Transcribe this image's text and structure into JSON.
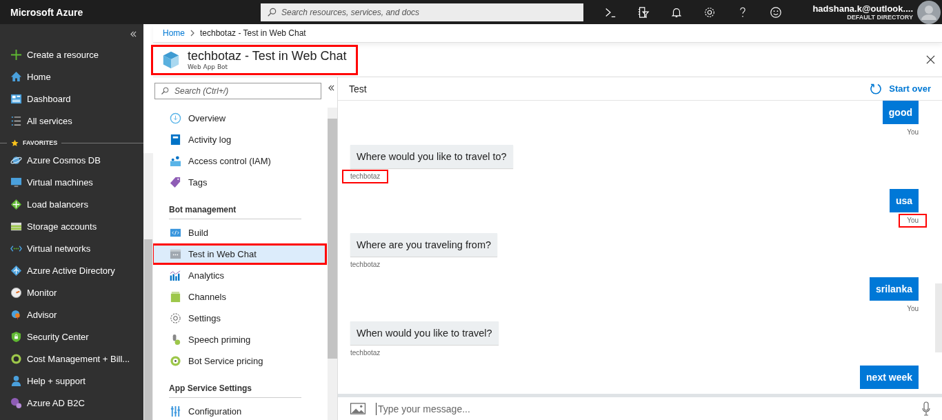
{
  "topbar": {
    "brand": "Microsoft Azure",
    "search": {
      "placeholder": "Search resources, services, and docs"
    },
    "user": {
      "email": "hadshana.k@outlook....",
      "directory": "DEFAULT DIRECTORY"
    }
  },
  "sidebar": {
    "items": [
      {
        "kind": "item",
        "label": "Create a resource"
      },
      {
        "kind": "item",
        "label": "Home"
      },
      {
        "kind": "item",
        "label": "Dashboard"
      },
      {
        "kind": "item",
        "label": "All services"
      },
      {
        "kind": "header",
        "label": "FAVORITES"
      },
      {
        "kind": "item",
        "label": "Azure Cosmos DB"
      },
      {
        "kind": "item",
        "label": "Virtual machines"
      },
      {
        "kind": "item",
        "label": "Load balancers"
      },
      {
        "kind": "item",
        "label": "Storage accounts"
      },
      {
        "kind": "item",
        "label": "Virtual networks"
      },
      {
        "kind": "item",
        "label": "Azure Active Directory"
      },
      {
        "kind": "item",
        "label": "Monitor"
      },
      {
        "kind": "item",
        "label": "Advisor"
      },
      {
        "kind": "item",
        "label": "Security Center"
      },
      {
        "kind": "item",
        "label": "Cost Management + Bill..."
      },
      {
        "kind": "item",
        "label": "Help + support"
      },
      {
        "kind": "item",
        "label": "Azure AD B2C"
      }
    ]
  },
  "breadcrumb": [
    {
      "label": "Home",
      "link": true
    },
    {
      "label": "techbotaz - Test in Web Chat",
      "link": false
    }
  ],
  "blade": {
    "title": "techbotaz - Test in Web Chat",
    "subtitle": "Web App Bot",
    "highlighted": true
  },
  "menu": {
    "search": {
      "placeholder": "Search (Ctrl+/)"
    },
    "items": [
      {
        "kind": "item",
        "label": "Overview",
        "selected": false,
        "highlighted": false
      },
      {
        "kind": "item",
        "label": "Activity log",
        "selected": false,
        "highlighted": false
      },
      {
        "kind": "item",
        "label": "Access control (IAM)",
        "selected": false,
        "highlighted": false
      },
      {
        "kind": "item",
        "label": "Tags",
        "selected": false,
        "highlighted": false
      },
      {
        "kind": "section",
        "label": "Bot management"
      },
      {
        "kind": "item",
        "label": "Build",
        "selected": false,
        "highlighted": false
      },
      {
        "kind": "item",
        "label": "Test in Web Chat",
        "selected": true,
        "highlighted": true
      },
      {
        "kind": "item",
        "label": "Analytics",
        "selected": false,
        "highlighted": false
      },
      {
        "kind": "item",
        "label": "Channels",
        "selected": false,
        "highlighted": false
      },
      {
        "kind": "item",
        "label": "Settings",
        "selected": false,
        "highlighted": false
      },
      {
        "kind": "item",
        "label": "Speech priming",
        "selected": false,
        "highlighted": false
      },
      {
        "kind": "item",
        "label": "Bot Service pricing",
        "selected": false,
        "highlighted": false
      },
      {
        "kind": "section",
        "label": "App Service Settings"
      },
      {
        "kind": "item",
        "label": "Configuration",
        "selected": false,
        "highlighted": false
      }
    ]
  },
  "chat": {
    "title": "Test",
    "start_over": "Start over",
    "input": {
      "placeholder": "Type your message..."
    },
    "messages": [
      {
        "kind": "user",
        "text": "good",
        "sender": "You",
        "highlighted": false
      },
      {
        "kind": "bot",
        "text": "Where would you like to travel to?",
        "sender": "techbotaz",
        "highlighted": true
      },
      {
        "kind": "user",
        "text": "usa",
        "sender": "You",
        "highlighted": true
      },
      {
        "kind": "bot",
        "text": "Where are you traveling from?",
        "sender": "techbotaz",
        "highlighted": false
      },
      {
        "kind": "user",
        "text": "srilanka",
        "sender": "You",
        "highlighted": false
      },
      {
        "kind": "bot",
        "text": "When would you like to travel?",
        "sender": "techbotaz",
        "highlighted": false
      },
      {
        "kind": "user",
        "text": "next week"
      }
    ]
  }
}
